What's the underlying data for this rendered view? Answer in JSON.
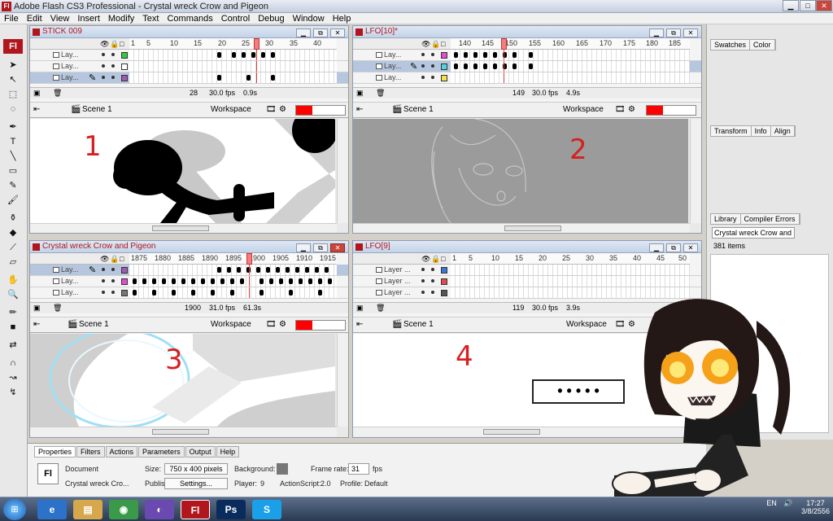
{
  "titlebar": {
    "title": "Adobe Flash CS3 Professional - Crystal wreck Crow and Pigeon"
  },
  "menubar": [
    "File",
    "Edit",
    "View",
    "Insert",
    "Modify",
    "Text",
    "Commands",
    "Control",
    "Debug",
    "Window",
    "Help"
  ],
  "windows": [
    {
      "name": "STICK 009",
      "number": "1",
      "rulers": [
        "1",
        "5",
        "10",
        "15",
        "20",
        "25",
        "30",
        "35",
        "40"
      ],
      "layers": [
        "Lay...",
        "Lay...",
        "Lay..."
      ],
      "colors": [
        "#2ecc40",
        "#ffffff",
        "#a05ab4"
      ],
      "frame": "28",
      "fps": "30.0 fps",
      "time": "0.9s",
      "scene": "Scene 1",
      "workspace": "Workspace"
    },
    {
      "name": "LFO[10]*",
      "number": "2",
      "rulers": [
        "140",
        "145",
        "150",
        "155",
        "160",
        "165",
        "170",
        "175",
        "180",
        "185"
      ],
      "layers": [
        "Lay...",
        "Lay...",
        "Lay..."
      ],
      "colors": [
        "#e24bd2",
        "#4fd5e6",
        "#f4e14b"
      ],
      "frame": "149",
      "fps": "30.0 fps",
      "time": "4.9s",
      "scene": "Scene 1",
      "workspace": "Workspace"
    },
    {
      "name": "Crystal wreck Crow and Pigeon",
      "number": "3",
      "rulers": [
        "1875",
        "1880",
        "1885",
        "1890",
        "1895",
        "1900",
        "1905",
        "1910",
        "1915"
      ],
      "layers": [
        "Lay...",
        "Lay...",
        "Lay..."
      ],
      "colors": [
        "#a05ab4",
        "#e24bd2",
        "#777777"
      ],
      "frame": "1900",
      "fps": "31.0 fps",
      "time": "61.3s",
      "scene": "Scene 1",
      "workspace": "Workspace"
    },
    {
      "name": "LFO[9]",
      "number": "4",
      "rulers": [
        "1",
        "5",
        "10",
        "15",
        "20",
        "25",
        "30",
        "35",
        "40",
        "45",
        "50"
      ],
      "layers": [
        "Layer ...",
        "Layer ...",
        "Layer ..."
      ],
      "colors": [
        "#3a78d8",
        "#e24b4b",
        "#555555"
      ],
      "frame": "119",
      "fps": "30.0 fps",
      "time": "3.9s",
      "scene": "Scene 1",
      "workspace": "Workspace"
    }
  ],
  "rightpanel": {
    "tabs1": [
      "Swatches",
      "Color"
    ],
    "tabs2": [
      "Transform",
      "Info",
      "Align"
    ],
    "tabs3": [
      "Library",
      "Compiler Errors"
    ],
    "library_doc": "Crystal wreck Crow and Pi",
    "items": "381 items"
  },
  "properties": {
    "tabs": [
      "Properties",
      "Filters",
      "Actions",
      "Parameters",
      "Output",
      "Help"
    ],
    "doc_label": "Document",
    "doc_name": "Crystal wreck Cro...",
    "size_label": "Size:",
    "size_value": "750 x 400 pixels",
    "publish_label": "Publish:",
    "settings": "Settings...",
    "background_label": "Background:",
    "player_label": "Player:",
    "player_value": "9",
    "as_label": "ActionScript:",
    "as_value": "2.0",
    "profile_label": "Profile:",
    "profile_value": "Default",
    "framerate_label": "Frame rate:",
    "framerate_value": "31",
    "fps": "fps"
  },
  "speech_bubble": "• • • • •",
  "taskbar": {
    "lang": "EN",
    "time": "17:27",
    "date": "3/8/2556"
  }
}
